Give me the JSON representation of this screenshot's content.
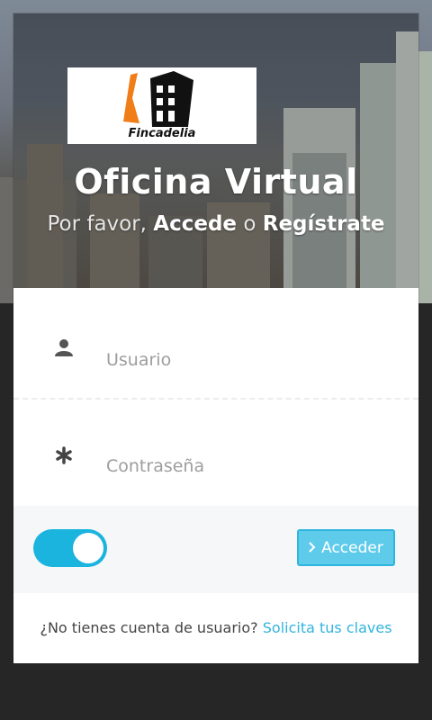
{
  "brand": {
    "logo_text": "Fincadelia"
  },
  "header": {
    "title": "Oficina Virtual",
    "subtitle_prefix": "Por favor,",
    "subtitle_login": "Accede",
    "subtitle_or": "o",
    "subtitle_register": "Regístrate"
  },
  "form": {
    "username_placeholder": "Usuario",
    "password_placeholder": "Contraseña",
    "remember_toggle_on": true,
    "submit_label": "Acceder"
  },
  "footer": {
    "question": "¿No tienes cuenta de usuario?",
    "link_label": "Solicita tus claves"
  },
  "colors": {
    "accent": "#1ab4de",
    "button": "#5fcbeb",
    "link": "#31b4dd",
    "page_bg": "#262626"
  },
  "icons": {
    "username": "user-icon",
    "password": "asterisk-icon",
    "submit": "chevron-right-icon"
  }
}
